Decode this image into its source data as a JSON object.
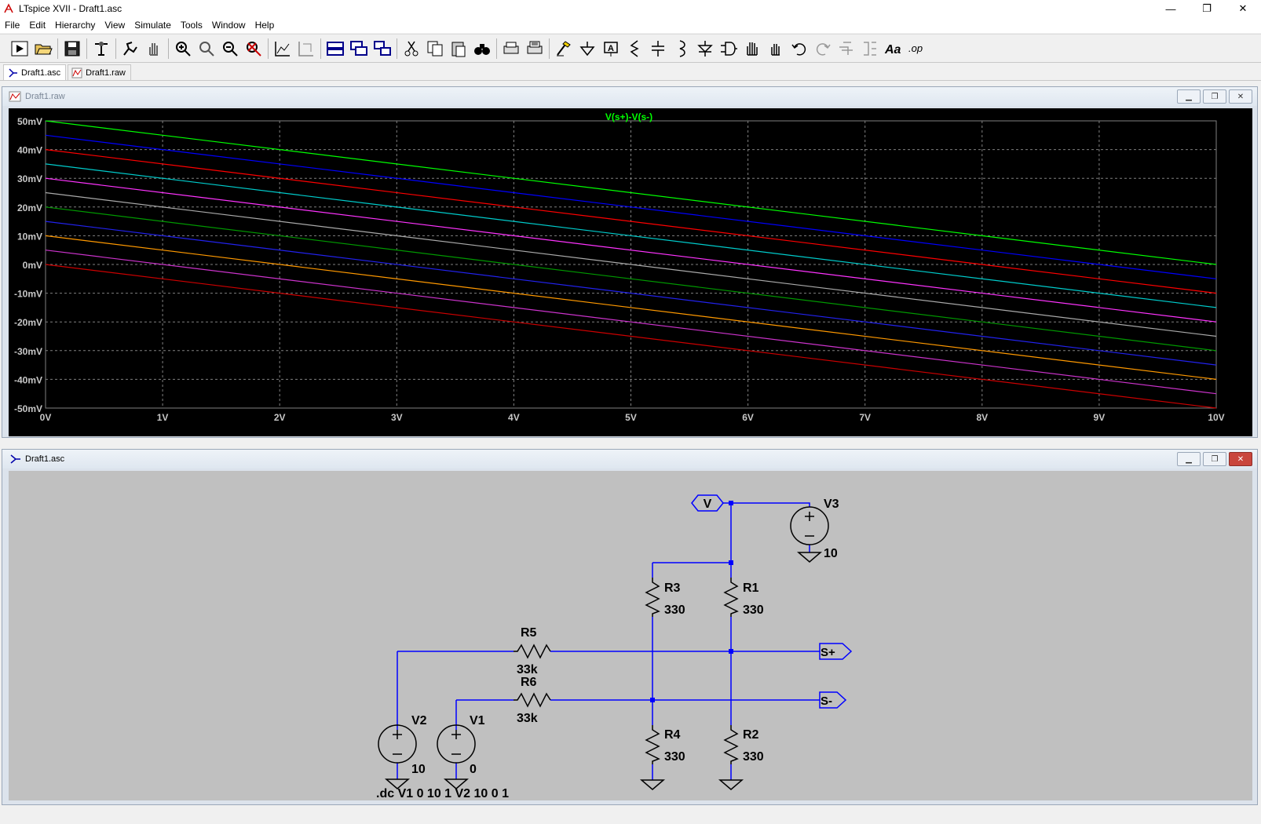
{
  "window": {
    "title": "LTspice XVII - Draft1.asc",
    "minimize": "—",
    "restore": "❐",
    "close": "✕"
  },
  "menu": [
    "File",
    "Edit",
    "Hierarchy",
    "View",
    "Simulate",
    "Tools",
    "Window",
    "Help"
  ],
  "toolbar_icons": [
    "run-icon",
    "open-icon",
    "save-icon",
    "control-panel-icon",
    "halt-icon",
    "pan-hand-icon",
    "zoom-in-icon",
    "zoom-area-icon",
    "zoom-out-icon",
    "zoom-fit-icon",
    "autorange-icon",
    "marker-icon",
    "tile-horizontal-icon",
    "cascade-icon",
    "tile-vertical-icon",
    "cut-icon",
    "copy-icon",
    "paste-icon",
    "find-icon",
    "print-icon",
    "print-preview-icon",
    "wire-icon",
    "ground-icon",
    "label-net-icon",
    "resistor-icon",
    "capacitor-icon",
    "inductor-icon",
    "diode-icon",
    "component-icon",
    "move-icon",
    "drag-icon",
    "undo-icon",
    "redo-icon",
    "rotate-icon",
    "mirror-icon",
    "text-icon",
    "spice-directive-icon"
  ],
  "tabs": [
    {
      "label": "Draft1.asc",
      "active": true
    },
    {
      "label": "Draft1.raw",
      "active": false
    }
  ],
  "plot_window": {
    "title": "Draft1.raw"
  },
  "schematic_window": {
    "title": "Draft1.asc"
  },
  "chart_data": {
    "type": "line",
    "title": "V(s+)-V(s-)",
    "title_color": "#00ff00",
    "xlabel": "",
    "ylabel": "",
    "xlim": [
      0,
      10
    ],
    "ylim": [
      -50,
      50
    ],
    "x_ticks": [
      "0V",
      "1V",
      "2V",
      "3V",
      "4V",
      "5V",
      "6V",
      "7V",
      "8V",
      "9V",
      "10V"
    ],
    "y_ticks": [
      "50mV",
      "40mV",
      "30mV",
      "20mV",
      "10mV",
      "0mV",
      "-10mV",
      "-20mV",
      "-30mV",
      "-40mV",
      "-50mV"
    ],
    "grid": true,
    "series": [
      {
        "color": "#00ff00",
        "x": [
          0,
          10
        ],
        "y": [
          50,
          0
        ]
      },
      {
        "color": "#0000ff",
        "x": [
          0,
          10
        ],
        "y": [
          45,
          -5
        ]
      },
      {
        "color": "#ff0000",
        "x": [
          0,
          10
        ],
        "y": [
          40,
          -10
        ]
      },
      {
        "color": "#00cccc",
        "x": [
          0,
          10
        ],
        "y": [
          35,
          -15
        ]
      },
      {
        "color": "#ff33ff",
        "x": [
          0,
          10
        ],
        "y": [
          30,
          -20
        ]
      },
      {
        "color": "#aaaaaa",
        "x": [
          0,
          10
        ],
        "y": [
          25,
          -25
        ]
      },
      {
        "color": "#009900",
        "x": [
          0,
          10
        ],
        "y": [
          20,
          -30
        ]
      },
      {
        "color": "#2222ee",
        "x": [
          0,
          10
        ],
        "y": [
          15,
          -35
        ]
      },
      {
        "color": "#ff9900",
        "x": [
          0,
          10
        ],
        "y": [
          10,
          -40
        ]
      },
      {
        "color": "#cc33cc",
        "x": [
          0,
          10
        ],
        "y": [
          5,
          -45
        ]
      },
      {
        "color": "#cc0000",
        "x": [
          0,
          10
        ],
        "y": [
          0,
          -50
        ]
      }
    ]
  },
  "schematic": {
    "v3": {
      "name": "V3",
      "value": "10"
    },
    "v2": {
      "name": "V2",
      "value": "10"
    },
    "v1": {
      "name": "V1",
      "value": "0"
    },
    "r1": {
      "name": "R1",
      "value": "330"
    },
    "r2": {
      "name": "R2",
      "value": "330"
    },
    "r3": {
      "name": "R3",
      "value": "330"
    },
    "r4": {
      "name": "R4",
      "value": "330"
    },
    "r5": {
      "name": "R5",
      "value": "33k"
    },
    "r6": {
      "name": "R6",
      "value": "33k"
    },
    "label_v": "V",
    "label_sp": "S+",
    "label_sm": "S-",
    "directive": ".dc V1 0 10 1 V2 10 0 1"
  },
  "colors": {
    "wire": "#0000ff",
    "schem_bg": "#c0c0c0",
    "plot_bg": "#000000",
    "grid": "#808080",
    "text": "#000000"
  }
}
